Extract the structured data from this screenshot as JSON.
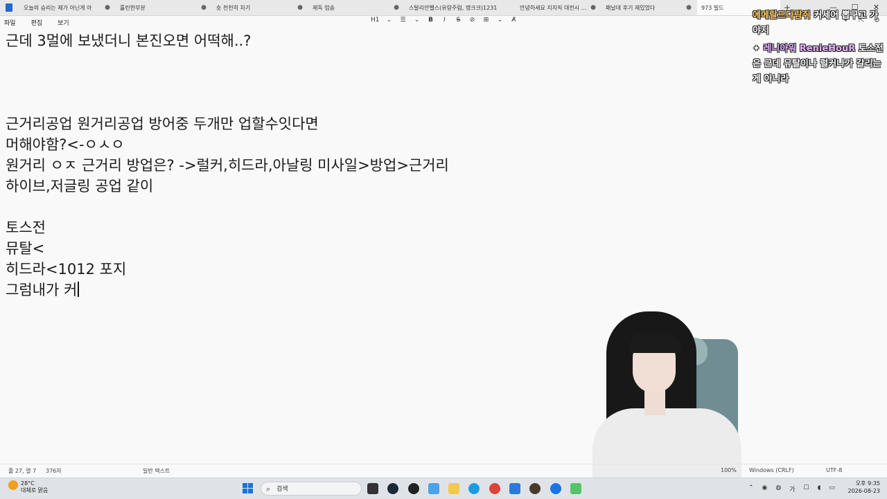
{
  "tabs": [
    {
      "label": "오늘의 승리는 제가 아닌게 아"
    },
    {
      "label": "흘린한부분"
    },
    {
      "label": "숏 천천히 차기"
    },
    {
      "label": "제독 업송"
    },
    {
      "label": "스탈리안벨스(유랑주럼, 캥크크)1231"
    },
    {
      "label": "안녕하세요 지지직 대전시 수원"
    },
    {
      "label": "패날데 후기 재밌었다"
    },
    {
      "label": "973 빌드"
    }
  ],
  "menu": {
    "file": "파일",
    "edit": "편집",
    "view": "보기"
  },
  "toolbar": {
    "heading": "H1",
    "list": "☰",
    "bold": "B",
    "italic": "I",
    "strike": "S",
    "link": "⊘",
    "table": "⊞",
    "clear": "A̸"
  },
  "editor_lines": [
    "근데 3멀에 보냈더니 본진오면 어떡해..?",
    "",
    "",
    "",
    "근거리공업 원거리공업 방어중 두개만 업할수잇다면",
    "머해야함?<-ㅇㅅㅇ",
    "원거리 ㅇㅈ 근거리 방업은? ->럴커,히드라,아날링 미사일>방업>근거리",
    "하이브,저글링 공업 같이",
    "",
    "토스전",
    "뮤탈<",
    "히드라<1012 포지",
    "그럼내가 커"
  ],
  "chat": {
    "msg1_name": "에메랄드다람쥐",
    "msg1_text": "커세어 뽑구고 가야지",
    "msg2_name": "레니아워 RenieHouR",
    "msg2_text": "토스전은 근데 뮤탈이나 럴커나가 갈리는게 아니라"
  },
  "status": {
    "position": "줄 27, 열 7",
    "chars": "376자",
    "format": "일반 텍스트",
    "zoom": "100%",
    "lineend": "Windows (CRLF)",
    "encoding": "UTF-8"
  },
  "taskbar": {
    "temp": "28°C",
    "weather": "대체로 맑음",
    "search": "검색",
    "ime": "가",
    "time_label": "오후 9:35",
    "date": "2026-08-23"
  },
  "window": {
    "minimize": "—",
    "maximize": "☐",
    "close": "✕",
    "newtab": "+"
  }
}
